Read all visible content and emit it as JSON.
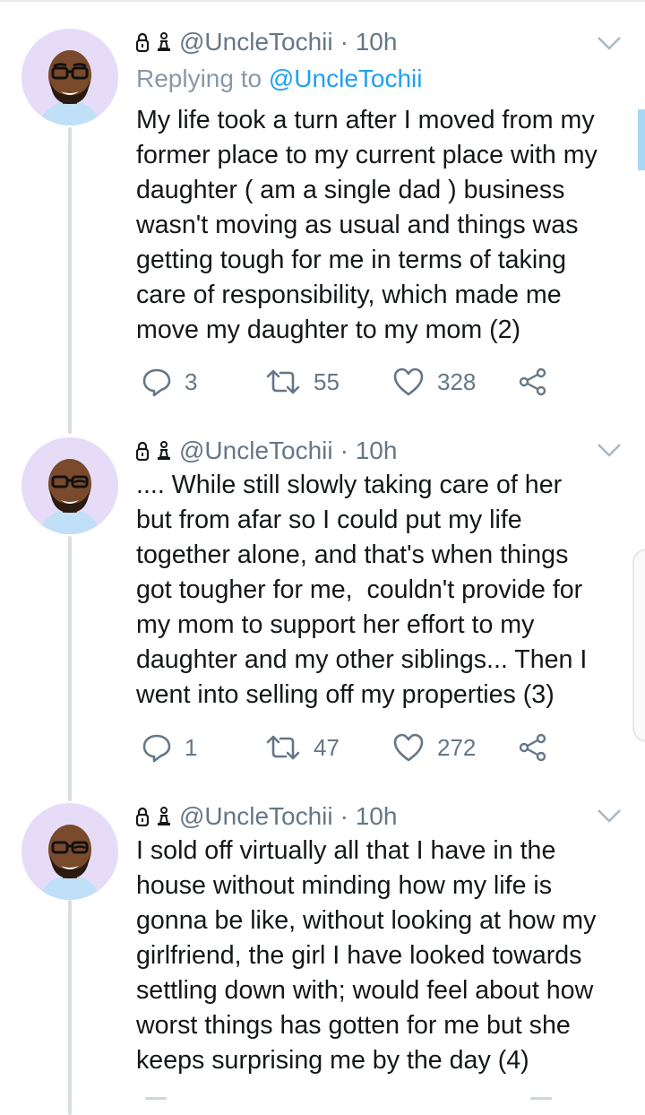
{
  "tweets": [
    {
      "handle": "@UncleTochii",
      "time": "· 10h",
      "replying_prefix": "Replying to ",
      "replying_handle": "@UncleTochii",
      "text": "My life took a turn after I moved from my\nformer place to my current place with my\ndaughter ( am a single dad ) business\nwasn't moving as usual and things was\ngetting tough for me in terms of taking\ncare of responsibility, which made me\nmove my daughter to my mom (2)",
      "replies": "3",
      "retweets": "55",
      "likes": "328"
    },
    {
      "handle": "@UncleTochii",
      "time": "· 10h",
      "text": ".... While still slowly taking care of her\nbut from afar so I could put my life\ntogether alone, and that's when things\ngot tougher for me,  couldn't provide for\nmy mom to support her effort to my\ndaughter and my other siblings... Then I\nwent into selling off my properties (3)",
      "replies": "1",
      "retweets": "47",
      "likes": "272"
    },
    {
      "handle": "@UncleTochii",
      "time": "· 10h",
      "text": "I sold off virtually all that I have in the\nhouse without minding how my life is\ngonna be like, without looking at how my\ngirlfriend, the girl I have looked towards\nsettling down with; would feel about how\nworst things has gotten for me but she\nkeeps surprising me by the day (4)"
    }
  ],
  "icons": {
    "badge": "lock-and-chess-pawn-icons",
    "menu": "chevron-down-icon",
    "reply": "reply-icon",
    "retweet": "retweet-icon",
    "like": "heart-icon",
    "share": "share-icon"
  },
  "colors": {
    "text": "#14171a",
    "muted": "#657786",
    "link": "#1da1f2",
    "avatar_bg": "#e6dcf8",
    "thread_line": "#d9dee2"
  }
}
